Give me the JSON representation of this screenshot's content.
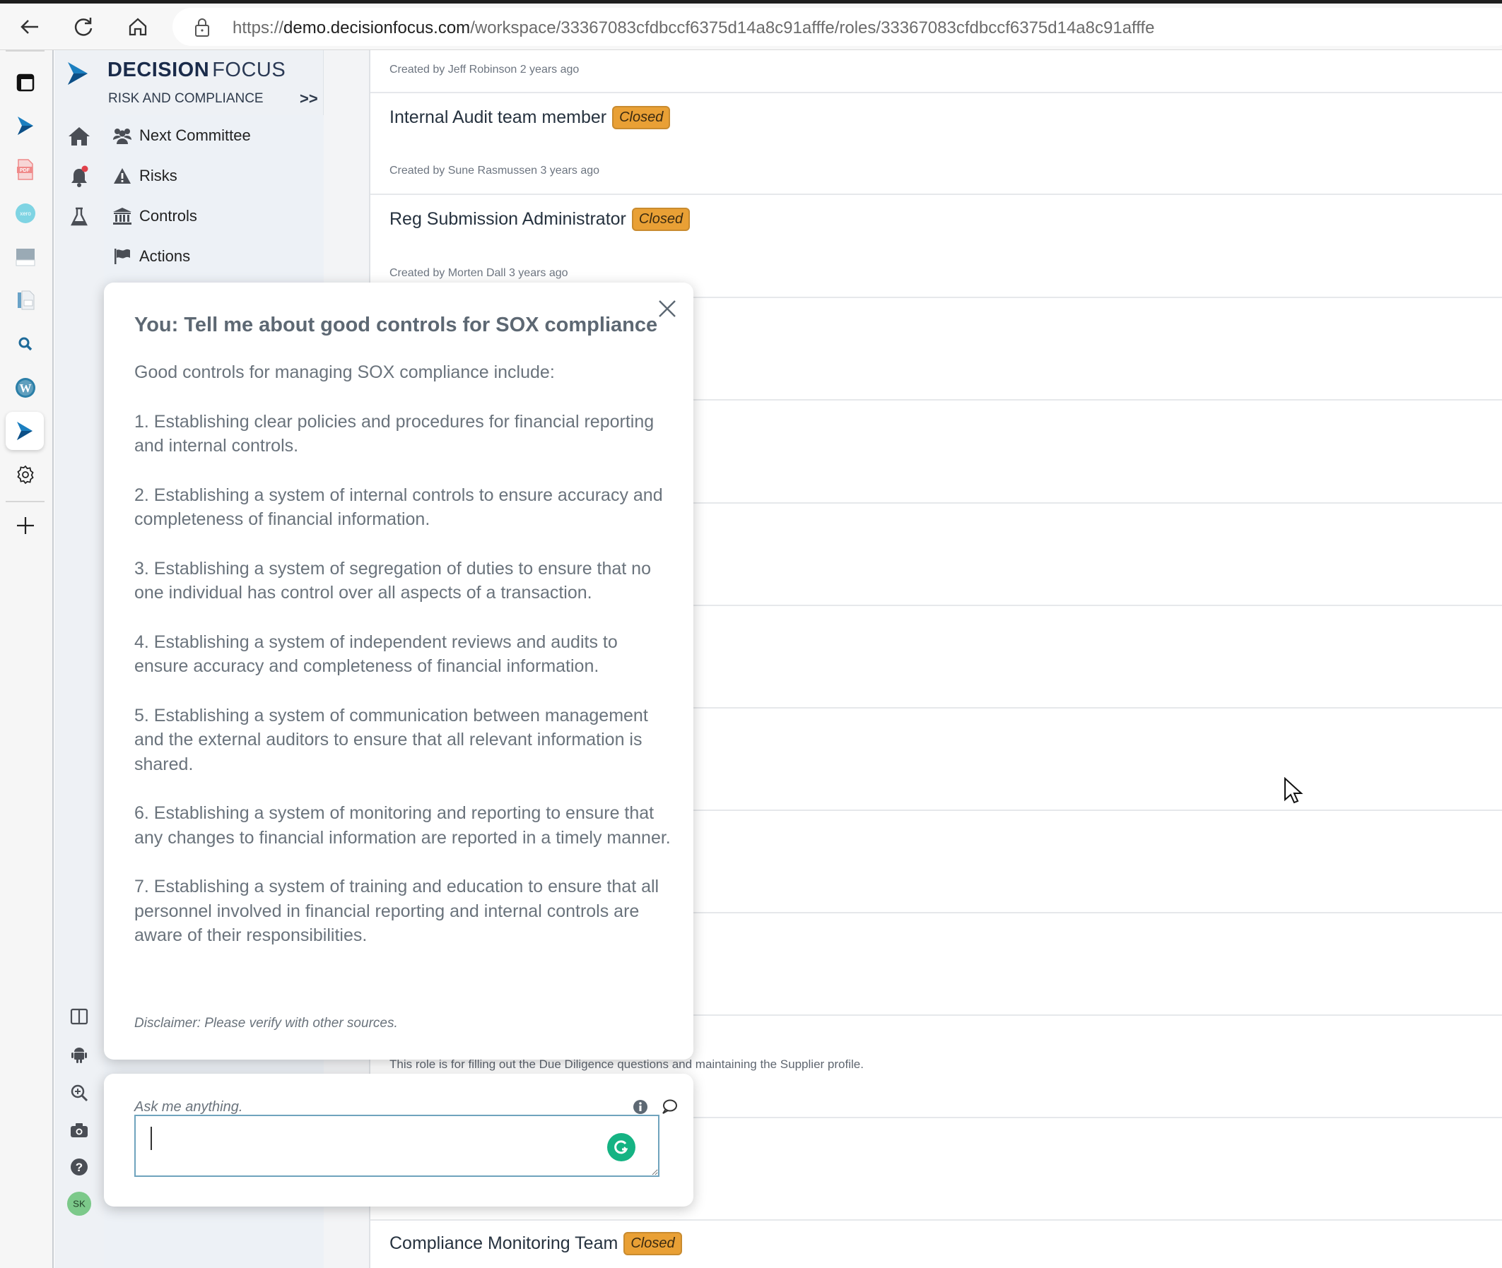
{
  "browser": {
    "url_prefix": "https://",
    "url_host": "demo.decisionfocus.com",
    "url_path": "/workspace/33367083cfdbccf6375d14a8c91afffe/roles/33367083cfdbccf6375d14a8c91afffe",
    "icons": [
      "back-icon",
      "reload-icon",
      "home-icon",
      "lock-icon"
    ]
  },
  "appbar": {
    "icons": [
      "tabs-icon",
      "decisionfocus-app-icon",
      "pdf-icon",
      "xero-icon",
      "window-icon",
      "document-icon",
      "search-icon",
      "wordpress-icon",
      "decisionfocus-active-icon",
      "settings-icon",
      "add-icon"
    ]
  },
  "nav": {
    "brand_bold": "DECISION",
    "brand_light": "FOCUS",
    "subtitle": "RISK AND COMPLIANCE",
    "expand_label": ">>",
    "items": [
      {
        "label": "Next Committee",
        "icon": "users-icon"
      },
      {
        "label": "Risks",
        "icon": "warning-icon"
      },
      {
        "label": "Controls",
        "icon": "bank-icon"
      },
      {
        "label": "Actions",
        "icon": "flag-icon"
      }
    ],
    "side_icons": [
      "home-icon",
      "bell-icon",
      "flask-icon"
    ],
    "bottom_icons": [
      "columns-icon",
      "android-icon",
      "zoom-icon",
      "camera-icon",
      "help-icon"
    ],
    "avatar_initials": "SK",
    "avatar_color": "#7cc98a"
  },
  "roles": [
    {
      "title": "",
      "status": "",
      "created": "Created by Jeff Robinson 2 years ago"
    },
    {
      "title": "Internal Audit team member",
      "status": "Closed",
      "created": "Created by Sune Rasmussen 3 years ago"
    },
    {
      "title": "Reg Submission Administrator",
      "status": "Closed",
      "created": "Created by Morten Dall 3 years ago"
    }
  ],
  "role_description_partial": "This role is for filling out the Due Diligence questions and maintaining the Supplier profile.",
  "role_bottom": {
    "title": "Compliance Monitoring Team",
    "status": "Closed"
  },
  "status_color": "#e9a035",
  "assistant": {
    "question": "You: Tell me about good controls for SOX compliance",
    "intro": "Good controls for managing SOX compliance include:",
    "points": [
      "1. Establishing clear policies and procedures for financial reporting and internal controls.",
      "2. Establishing a system of internal controls to ensure accuracy and completeness of financial information.",
      "3. Establishing a system of segregation of duties to ensure that no one individual has control over all aspects of a transaction.",
      "4. Establishing a system of independent reviews and audits to ensure accuracy and completeness of financial information.",
      "5. Establishing a system of communication between management and the external auditors to ensure that all relevant information is shared.",
      "6. Establishing a system of monitoring and reporting to ensure that any changes to financial information are reported in a timely manner.",
      "7. Establishing a system of training and education to ensure that all personnel involved in financial reporting and internal controls are aware of their responsibilities."
    ],
    "disclaimer": "Disclaimer: Please verify with other sources.",
    "ask_label": "Ask me anything.",
    "input_value": "",
    "grammarly_letter": "G"
  }
}
